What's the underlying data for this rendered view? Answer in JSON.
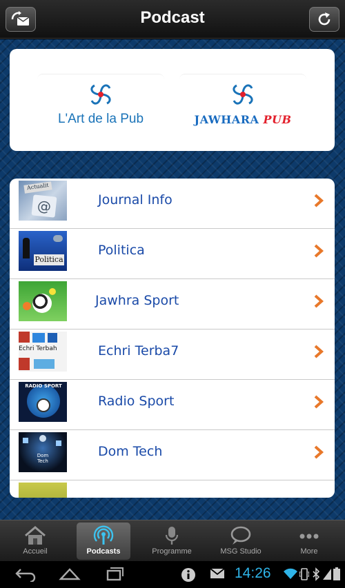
{
  "header": {
    "title": "Podcast"
  },
  "banners": [
    {
      "text": "L'Art de la Pub"
    },
    {
      "text_main": "JAWHARA",
      "text_accent": "PUB"
    }
  ],
  "podcasts": [
    {
      "label": "Journal Info",
      "thumb_text": "Actualit"
    },
    {
      "label": "Politica",
      "thumb_text": "Politica"
    },
    {
      "label": "Jawhra Sport"
    },
    {
      "label": "Echri Terba7",
      "thumb_text": "Echri Terbah"
    },
    {
      "label": "Radio Sport",
      "thumb_text": "RADIO SPORT"
    },
    {
      "label": "Dom Tech",
      "thumb_text": "Dom Tech"
    }
  ],
  "tabs": [
    {
      "label": "Accueil",
      "icon": "home-icon"
    },
    {
      "label": "Podcasts",
      "icon": "podcast-icon",
      "active": true
    },
    {
      "label": "Programme",
      "icon": "microphone-icon"
    },
    {
      "label": "MSG Studio",
      "icon": "speech-bubble-icon"
    },
    {
      "label": "More",
      "icon": "more-icon"
    }
  ],
  "status": {
    "time": "14:26"
  },
  "colors": {
    "accent": "#1a4aa8",
    "chevron": "#e8782a",
    "clock": "#2fb4e8"
  }
}
